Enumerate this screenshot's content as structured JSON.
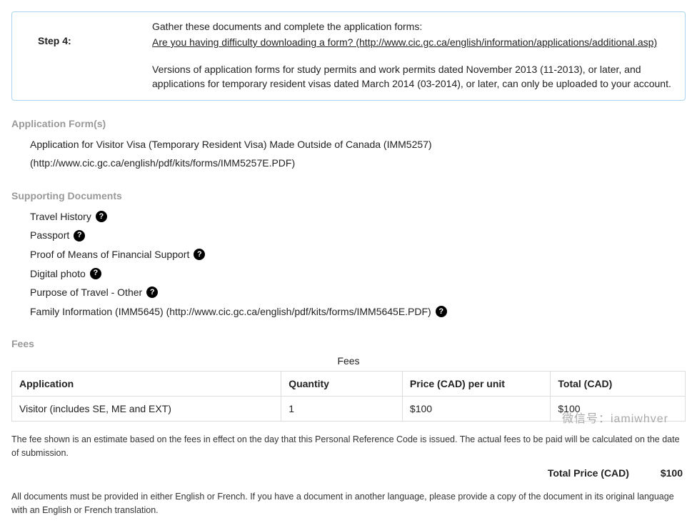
{
  "step": {
    "label": "Step 4:",
    "gather": "Gather these documents and complete the application forms:",
    "link": "Are you having difficulty downloading a form? (http://www.cic.gc.ca/english/information/applications/additional.asp)",
    "versions": "Versions of application forms for study permits and work permits dated November 2013 (11-2013), or later, and applications for temporary resident visas dated March 2014 (03-2014), or later, can only be uploaded to your account."
  },
  "forms": {
    "title": "Application Form(s)",
    "item": "Application for Visitor Visa (Temporary Resident Visa) Made Outside of Canada (IMM5257) (http://www.cic.gc.ca/english/pdf/kits/forms/IMM5257E.PDF)"
  },
  "supporting": {
    "title": "Supporting Documents",
    "items": [
      "Travel History",
      "Passport",
      "Proof of Means of Financial Support",
      "Digital photo",
      "Purpose of Travel - Other",
      "Family Information (IMM5645) (http://www.cic.gc.ca/english/pdf/kits/forms/IMM5645E.PDF)"
    ]
  },
  "fees": {
    "title": "Fees",
    "caption": "Fees",
    "header": {
      "app": "Application",
      "qty": "Quantity",
      "unit": "Price (CAD) per unit",
      "total": "Total (CAD)"
    },
    "row": {
      "app": "Visitor (includes SE, ME and EXT)",
      "qty": "1",
      "unit": "$100",
      "total": "$100"
    },
    "estimate": "The fee shown is an estimate based on the fees in effect on the day that this Personal Reference Code is issued. The actual fees to be paid will be calculated on the date of submission.",
    "total_label": "Total Price (CAD)",
    "total_value": "$100",
    "lang_note": "All documents must be provided in either English or French. If you have a document in another language, please provide a copy of the document in its original language with an English or French translation."
  },
  "watermark": "微信号：iamiwhver"
}
